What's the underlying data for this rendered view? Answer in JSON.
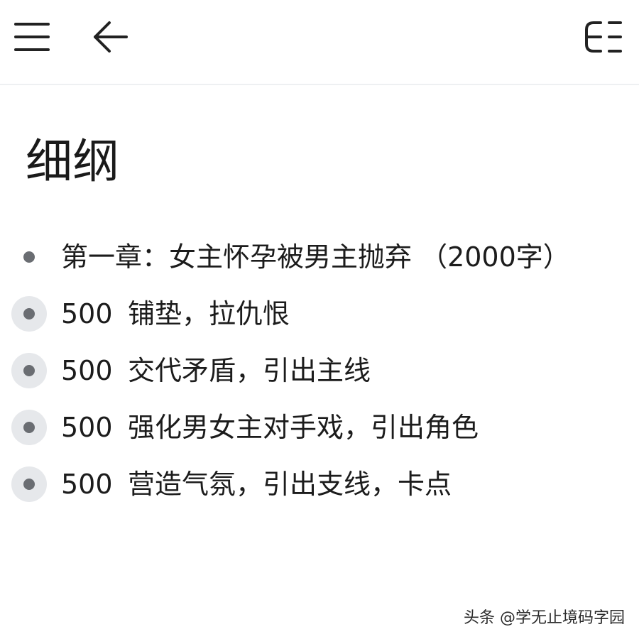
{
  "toolbar": {
    "menu_icon": "menu-icon",
    "back_icon": "arrow-left-icon",
    "outline_icon": "outline-toc-icon"
  },
  "document": {
    "title": "细纲"
  },
  "outline": {
    "items": [
      {
        "number": "",
        "text": "第一章：女主怀孕被男主抛弃 （2000字）"
      },
      {
        "number": "500",
        "text": "铺垫，拉仇恨"
      },
      {
        "number": "500",
        "text": "交代矛盾，引出主线"
      },
      {
        "number": "500",
        "text": "强化男女主对手戏，引出角色"
      },
      {
        "number": "500",
        "text": "营造气氛，引出支线，卡点"
      }
    ]
  },
  "watermark": {
    "text": "头条 @学无止境码字园"
  },
  "colors": {
    "bullet": "#6a6d72",
    "bullet_ring": "#e6e8eb",
    "divider": "#eef0f2"
  }
}
